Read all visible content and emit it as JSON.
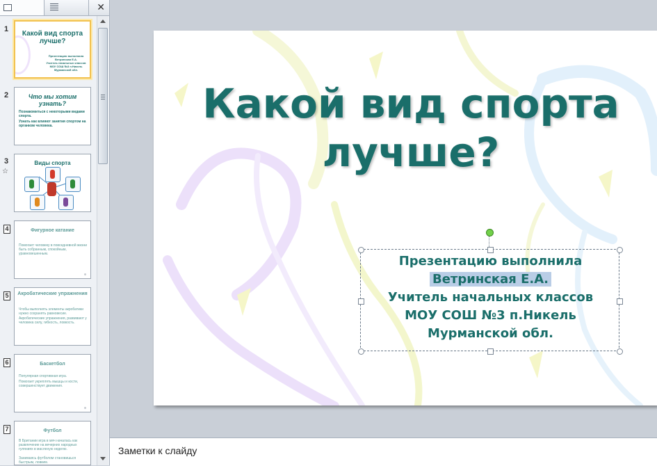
{
  "pane": {
    "close_glyph": "✕",
    "scroll_grip": "≡",
    "slides": [
      {
        "number": "1",
        "title": "Какой вид спорта лучше?",
        "lines": [
          "Презентацию выполнила",
          "Ветринская Е.А.",
          "Учитель начальных классов",
          "МОУ СОШ №3 п.Никель",
          "Мурманской обл."
        ],
        "selected": true
      },
      {
        "number": "2",
        "title": "Что мы хотим узнать?",
        "bullets": [
          "Познакомиться с некоторыми видами спорта.",
          "Узнать как влияют занятия спортом на организм человека."
        ]
      },
      {
        "number": "3",
        "title": "Виды спорта",
        "has_animation": true,
        "animation_icon": "star-icon"
      },
      {
        "number": "4",
        "title": "Фигурное катание",
        "hidden": true,
        "bullets": [
          "Помогает человеку в повседневной жизни быть собранным, спокойным, уравновешенным."
        ]
      },
      {
        "number": "5",
        "title": "Акробатические упражнения",
        "hidden": true,
        "bullets": [
          "Чтобы выполнять элементы акробатики нужно сохранять равновесие.",
          "Акробатические упражнения, развивают у человека силу, гибкость, ловкость."
        ]
      },
      {
        "number": "6",
        "title": "Баскетбол",
        "hidden": true,
        "bullets": [
          "Популярная спортивная игра.",
          "Помогает укреплять мышцы и кости, совершенствует движения."
        ]
      },
      {
        "number": "7",
        "title": "Футбол",
        "hidden": true,
        "bullets": [
          "В Британии игра в мяч началась как развлечение на вечерних народных гуляниях в масленую неделю.",
          "Занимаясь футболом становишься быстрым, ловким."
        ]
      }
    ]
  },
  "slide": {
    "title_line1": "Какой вид спорта",
    "title_line2": "лучше?",
    "subtitle": {
      "line1": "Презентацию выполнила",
      "line2": "Ветринская Е.А.",
      "line3": "Учитель начальных классов",
      "line4": "МОУ СОШ №3 п.Никель",
      "line5": "Мурманской обл."
    }
  },
  "notes": {
    "placeholder": "Заметки к слайду"
  },
  "colors": {
    "accent_text": "#1a6e6a",
    "selection_highlight": "#b9cde6",
    "thumb_selected_border": "#f2c14e"
  }
}
